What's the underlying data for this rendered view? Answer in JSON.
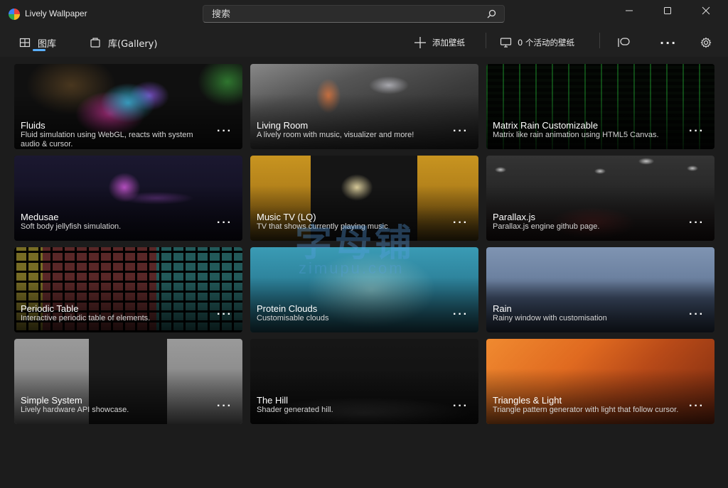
{
  "window": {
    "title": "Lively Wallpaper"
  },
  "search": {
    "placeholder": "搜索"
  },
  "nav": {
    "gallery_label": "图库",
    "library_label": "库(Gallery)"
  },
  "toolbar": {
    "add_wallpaper": "添加壁纸",
    "active_wallpapers": "0 个活动的壁纸",
    "more": "···"
  },
  "watermark": {
    "main": "字母铺",
    "sub": "zimupu.com"
  },
  "accent_color": "#5bb0ff",
  "cards": [
    {
      "title": "Fluids",
      "desc": "Fluid simulation using WebGL, reacts with system audio & cursor.",
      "more": "···"
    },
    {
      "title": "Living Room",
      "desc": "A lively room with music, visualizer and more!",
      "more": "···"
    },
    {
      "title": "Matrix Rain Customizable",
      "desc": "Matrix like rain animation using HTML5 Canvas.",
      "more": "···"
    },
    {
      "title": "Medusae",
      "desc": "Soft body jellyfish simulation.",
      "more": "···"
    },
    {
      "title": "Music TV (LQ)",
      "desc": "TV that shows currently playing music",
      "more": "···"
    },
    {
      "title": "Parallax.js",
      "desc": "Parallax.js engine github page.",
      "more": "···"
    },
    {
      "title": "Periodic Table",
      "desc": "Interactive periodic table of elements.",
      "more": "···"
    },
    {
      "title": "Protein Clouds",
      "desc": "Customisable clouds",
      "more": "···"
    },
    {
      "title": "Rain",
      "desc": "Rainy window with customisation",
      "more": "···"
    },
    {
      "title": "Simple System",
      "desc": "Lively hardware API showcase.",
      "more": "···"
    },
    {
      "title": "The Hill",
      "desc": "Shader generated hill.",
      "more": "···"
    },
    {
      "title": "Triangles & Light",
      "desc": "Triangle pattern generator with light that follow cursor.",
      "more": "···"
    }
  ]
}
